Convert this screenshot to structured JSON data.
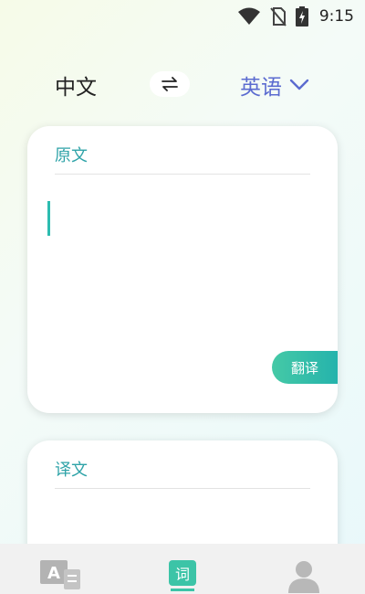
{
  "status_bar": {
    "time": "9:15",
    "icons": [
      "wifi-icon",
      "no-sim-icon",
      "battery-charging-icon"
    ]
  },
  "language_bar": {
    "source_language": "中文",
    "swap_icon": "swap-arrows-icon",
    "target_language": "英语",
    "dropdown_icon": "chevron-down-icon"
  },
  "source_card": {
    "title": "原文",
    "input_value": "",
    "translate_button_label": "翻译"
  },
  "result_card": {
    "title": "译文"
  },
  "bottom_nav": {
    "items": [
      {
        "icon": "translate-icon"
      },
      {
        "icon": "dictionary-icon",
        "badge_text": "词",
        "active": true
      },
      {
        "icon": "profile-icon"
      }
    ]
  },
  "colors": {
    "accent_teal": "#2fa3a8",
    "target_language": "#5b6bd0",
    "button_gradient_start": "#45c9a6",
    "button_gradient_end": "#25b3ac",
    "nav_background": "#f1f1f1"
  }
}
